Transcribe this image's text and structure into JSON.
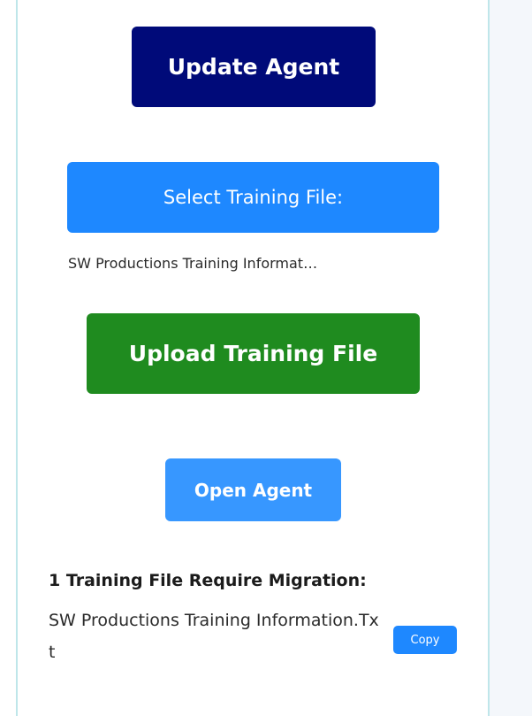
{
  "actions": {
    "update_agent_label": "Update Agent",
    "select_training_file_label": "Select Training File:",
    "selected_file_name": "SW Productions Training Informat…",
    "upload_training_file_label": "Upload Training File",
    "open_agent_label": "Open Agent"
  },
  "migration": {
    "title": "1 Training File Require Migration:",
    "file_name": "SW Productions Training Information.Txt",
    "copy_label": "Copy"
  },
  "colors": {
    "update_button": "#000a79",
    "select_button": "#1e88ff",
    "upload_button": "#1f8b1f",
    "open_button": "#3797ff",
    "copy_button": "#1e88ff"
  }
}
